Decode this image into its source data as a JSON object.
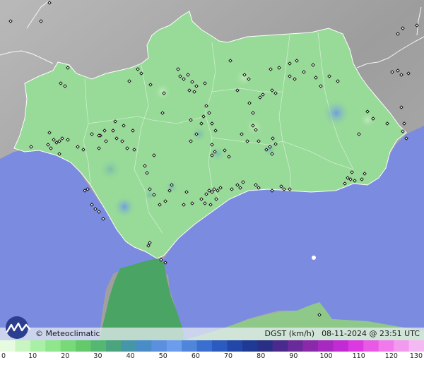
{
  "brand": "Meteoclimatic",
  "variable_label": "DGST (km/h)",
  "timestamp": "08-11-2024 @ 23:51 UTC",
  "legend": {
    "ticks": [
      "0",
      "10",
      "20",
      "30",
      "40",
      "50",
      "60",
      "70",
      "80",
      "90",
      "100",
      "110",
      "120",
      "130"
    ],
    "colors": [
      "#e6fbe0",
      "#c8f5c2",
      "#aaefa6",
      "#8fe68c",
      "#78d978",
      "#63c96a",
      "#55b872",
      "#4aa57e",
      "#4796a8",
      "#4a8cc8",
      "#5a90de",
      "#6c9cec",
      "#4f86dc",
      "#3a6fcf",
      "#2c5bbf",
      "#2347a8",
      "#1f3a94",
      "#2a2f86",
      "#4a2a8e",
      "#6a2a9a",
      "#8a2aaa",
      "#a62ac0",
      "#c22ad4",
      "#da3ae0",
      "#e85ae6",
      "#f07aec",
      "#f29aee",
      "#f4b8f2"
    ]
  },
  "colors": {
    "sea": "#7b8be0",
    "land": "#98da98",
    "terrain": "#a9a9a9",
    "border": "#ffffff",
    "station": "#000000"
  }
}
